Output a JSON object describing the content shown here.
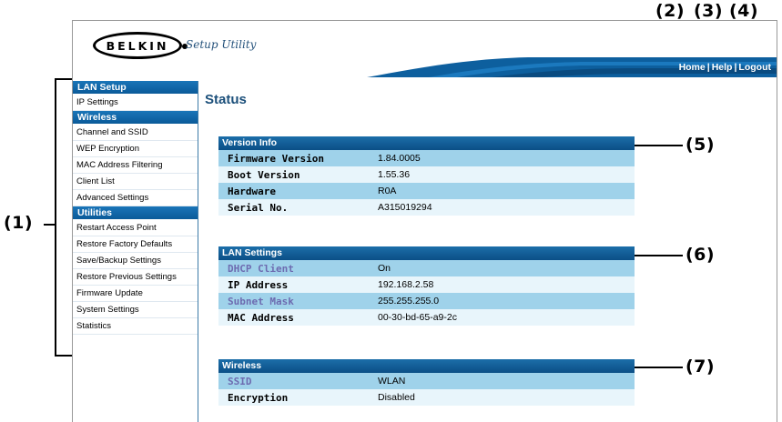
{
  "callouts": {
    "c1": "(1)",
    "c2": "(2)",
    "c3": "(3)",
    "c4": "(4)",
    "c5": "(5)",
    "c6": "(6)",
    "c7": "(7)"
  },
  "header": {
    "brand": "BELKIN",
    "app_name": "Setup Utility",
    "links": {
      "home": "Home",
      "help": "Help",
      "logout": "Logout",
      "separator": "|"
    },
    "colors": {
      "band": "#0d5f9e",
      "accent": "#1f7fc6"
    }
  },
  "sidebar": {
    "lan_setup": {
      "heading": "LAN Setup",
      "items": [
        "IP Settings"
      ]
    },
    "wireless": {
      "heading": "Wireless",
      "items": [
        "Channel and SSID",
        "WEP Encryption",
        "MAC Address Filtering",
        "Client List",
        "Advanced Settings"
      ]
    },
    "utilities": {
      "heading": "Utilities",
      "items": [
        "Restart Access Point",
        "Restore Factory Defaults",
        "Save/Backup Settings",
        "Restore Previous Settings",
        "Firmware Update",
        "System Settings",
        "Statistics"
      ]
    }
  },
  "main": {
    "title": "Status",
    "version_info": {
      "heading": "Version Info",
      "rows": [
        {
          "label": "Firmware Version",
          "value": "1.84.0005"
        },
        {
          "label": "Boot Version",
          "value": "1.55.36"
        },
        {
          "label": "Hardware",
          "value": "R0A"
        },
        {
          "label": "Serial No.",
          "value": "A315019294"
        }
      ]
    },
    "lan_settings": {
      "heading": "LAN Settings",
      "rows": [
        {
          "label": "DHCP Client",
          "value": "On"
        },
        {
          "label": "IP Address",
          "value": "192.168.2.58"
        },
        {
          "label": "Subnet Mask",
          "value": "255.255.255.0"
        },
        {
          "label": "MAC Address",
          "value": "00-30-bd-65-a9-2c"
        }
      ]
    },
    "wireless": {
      "heading": "Wireless",
      "rows": [
        {
          "label": "SSID",
          "value": "WLAN"
        },
        {
          "label": "Encryption",
          "value": "Disabled"
        }
      ]
    }
  }
}
